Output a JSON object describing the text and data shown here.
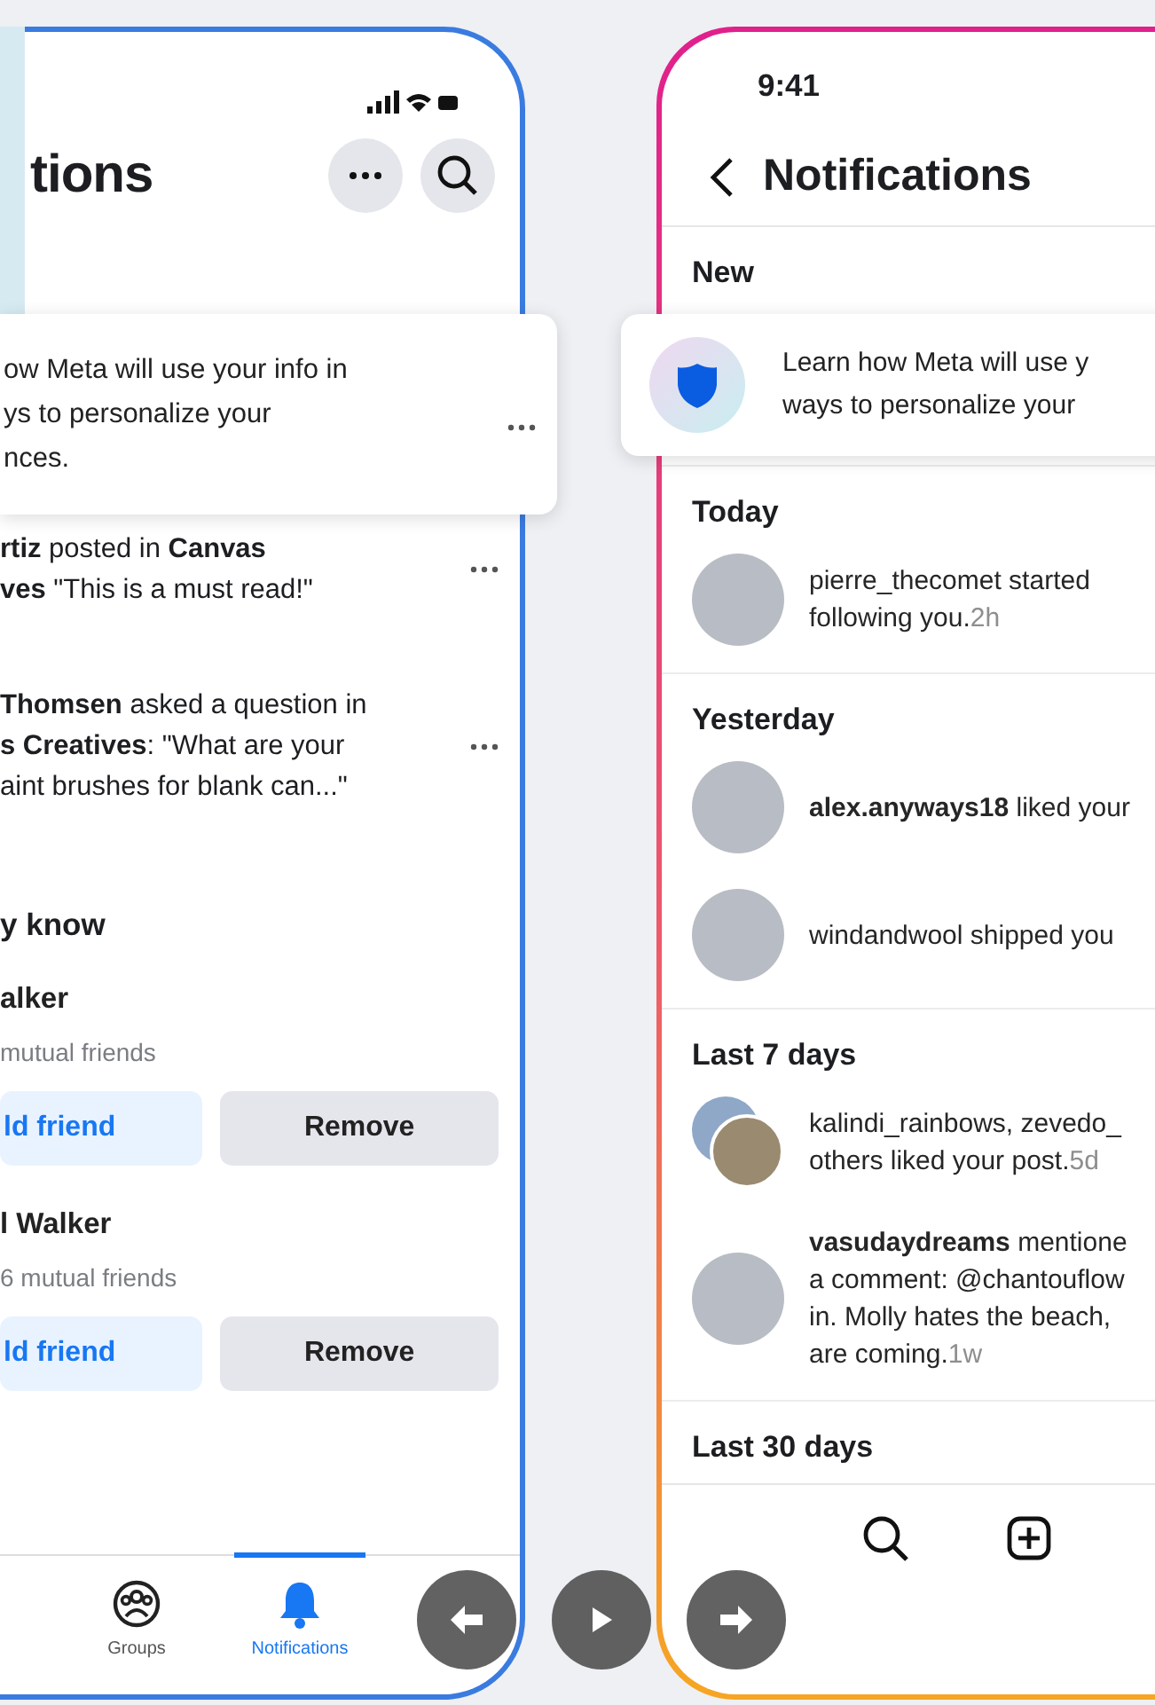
{
  "left_screen": {
    "title": "tions",
    "card": {
      "text": "ow Meta will use your info in\nys to personalize your\nnces."
    },
    "notifications": [
      {
        "text": "**rtiz** posted in **Canvas**\n**ves** \"This is a must read!\""
      },
      {
        "text": "**Thomsen** asked a question in\n**s Creatives**: \"What are your\naint brushes for blank can...\""
      }
    ],
    "people_section": {
      "heading": "y know",
      "people": [
        {
          "name": "alker",
          "mutual": "mutual friends",
          "add_label": "ld friend",
          "remove_label": "Remove"
        },
        {
          "name": "l Walker",
          "mutual": "6 mutual friends",
          "add_label": "ld friend",
          "remove_label": "Remove"
        }
      ]
    },
    "nav": [
      {
        "kind": "groups",
        "label": "Groups",
        "selected": false
      },
      {
        "kind": "bell",
        "label": "Notifications",
        "selected": true
      }
    ]
  },
  "right_screen": {
    "time": "9:41",
    "title": "Notifications",
    "new_heading": "New",
    "card": {
      "text": "Learn how Meta will use y\nways to personalize your"
    },
    "sections": [
      {
        "heading": "Today",
        "items": [
          {
            "kind": "single",
            "text": "pierre_thecomet started\nfollowing you.",
            "time": "2h"
          }
        ]
      },
      {
        "heading": "Yesterday",
        "items": [
          {
            "kind": "single",
            "text": "**alex.anyways18** liked your"
          },
          {
            "kind": "single",
            "text": "windandwool shipped you"
          }
        ]
      },
      {
        "heading": "Last 7 days",
        "items": [
          {
            "kind": "double",
            "text": "kalindi_rainbows, zevedo_\nothers liked your post.",
            "time": "5d"
          },
          {
            "kind": "single",
            "text": "**vasudaydreams** mentione\na comment: @chantouflow\nin. Molly hates the beach,\nare coming.",
            "time": "1w"
          }
        ]
      }
    ],
    "last_heading": "Last 30 days",
    "nav": [
      {
        "kind": "search"
      },
      {
        "kind": "plus"
      }
    ]
  },
  "player_controls": [
    {
      "kind": "back"
    },
    {
      "kind": "play"
    },
    {
      "kind": "forward"
    }
  ]
}
